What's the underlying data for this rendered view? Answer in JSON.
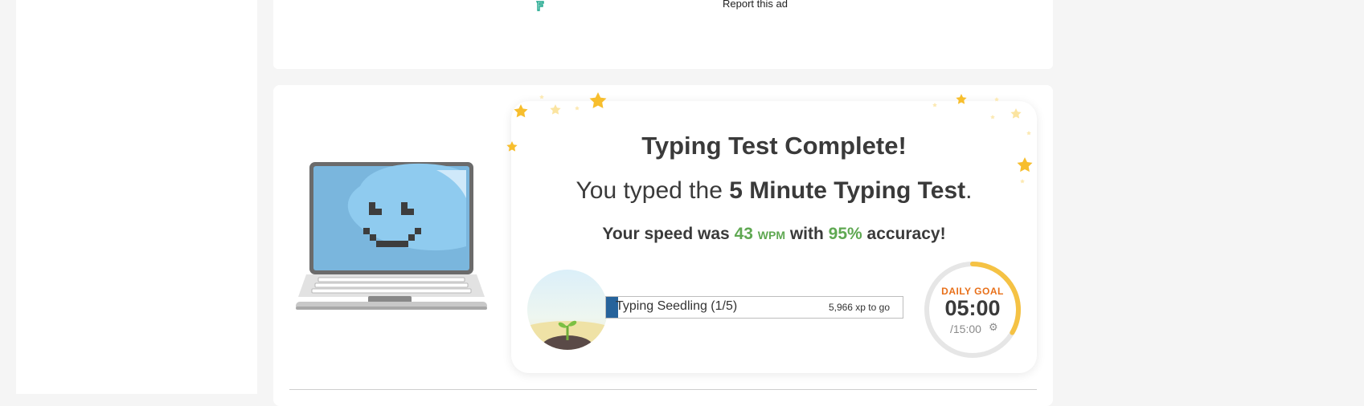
{
  "ad": {
    "report_label": "Report this ad"
  },
  "result": {
    "title": "Typing Test Complete!",
    "subtitle_prefix": "You typed the ",
    "test_name": "5 Minute Typing Test",
    "subtitle_suffix": ".",
    "speed_prefix": "Your speed was ",
    "wpm": "43",
    "wpm_unit": "WPM",
    "with_word": " with ",
    "accuracy": "95%",
    "accuracy_suffix": " accuracy!"
  },
  "progress": {
    "rank_label": "Typing Seedling (1/5)",
    "xp_to_go": "5,966 xp to go",
    "fill_fraction": 0.04
  },
  "daily_goal": {
    "label": "DAILY GOAL",
    "time": "05:00",
    "total": "/15:00",
    "fraction": 0.333
  },
  "icons": {
    "settings": "gear-icon",
    "laptop": "smiling-laptop-icon",
    "seedling": "seedling-icon"
  },
  "colors": {
    "accent_green": "#5fa852",
    "goal_orange": "#e8701a",
    "goal_ring": "#f5c244",
    "progress_fill": "#27639b"
  }
}
